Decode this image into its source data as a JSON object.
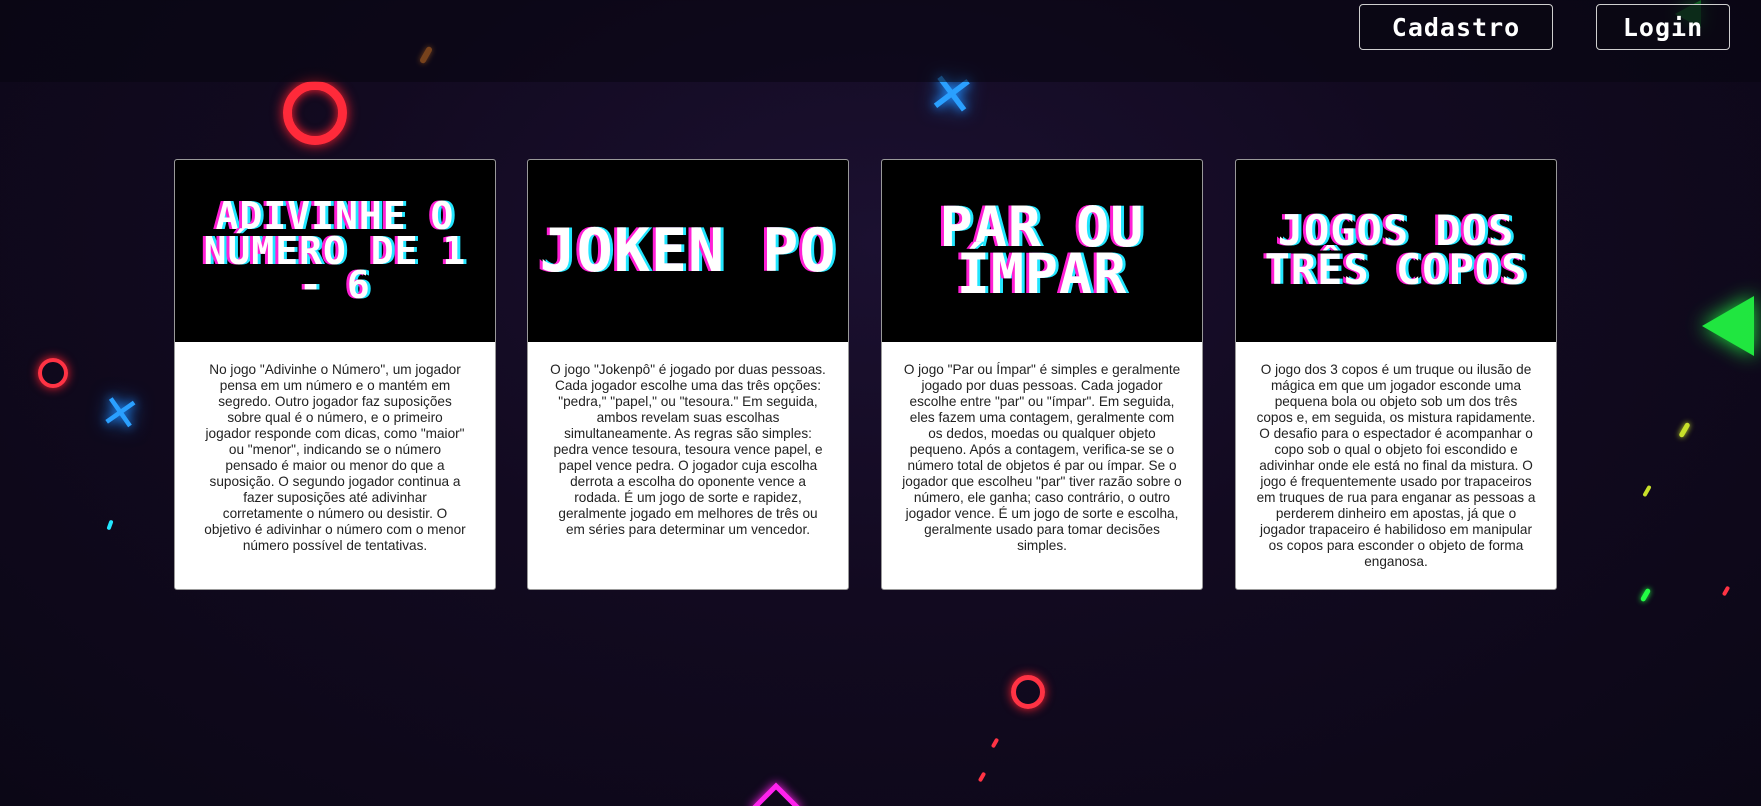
{
  "nav": {
    "cadastro_label": "Cadastro",
    "login_label": "Login"
  },
  "games": [
    {
      "title": "Adivinhe o Número de 1 - 6",
      "description": "No jogo \"Adivinhe o Número\", um jogador pensa em um número e o mantém em segredo. Outro jogador faz suposições sobre qual é o número, e o primeiro jogador responde com dicas, como \"maior\" ou \"menor\", indicando se o número pensado é maior ou menor do que a suposição. O segundo jogador continua a fazer suposições até adivinhar corretamente o número ou desistir. O objetivo é adivinhar o número com o menor número possível de tentativas."
    },
    {
      "title": "Joken Po",
      "description": "O jogo \"Jokenpô\" é jogado por duas pessoas. Cada jogador escolhe uma das três opções: \"pedra,\" \"papel,\" ou \"tesoura.\" Em seguida, ambos revelam suas escolhas simultaneamente. As regras são simples: pedra vence tesoura, tesoura vence papel, e papel vence pedra. O jogador cuja escolha derrota a escolha do oponente vence a rodada. É um jogo de sorte e rapidez, geralmente jogado em melhores de três ou em séries para determinar um vencedor."
    },
    {
      "title": "Par ou Ímpar",
      "description": "O jogo \"Par ou Ímpar\" é simples e geralmente jogado por duas pessoas. Cada jogador escolhe entre \"par\" ou \"ímpar\". Em seguida, eles fazem uma contagem, geralmente com os dedos, moedas ou qualquer objeto pequeno. Após a contagem, verifica-se se o número total de objetos é par ou ímpar. Se o jogador que escolheu \"par\" tiver razão sobre o número, ele ganha; caso contrário, o outro jogador vence. É um jogo de sorte e escolha, geralmente usado para tomar decisões simples."
    },
    {
      "title": "Jogos dos Três Copos",
      "description": "O jogo dos 3 copos é um truque ou ilusão de mágica em que um jogador esconde uma pequena bola ou objeto sob um dos três copos e, em seguida, os mistura rapidamente. O desafio para o espectador é acompanhar o copo sob o qual o objeto foi escondido e adivinhar onde ele está no final da mistura. O jogo é frequentemente usado por trapaceiros em truques de rua para enganar as pessoas a perderem dinheiro em apostas, já que o jogador trapaceiro é habilidoso em manipular os copos para esconder o objeto de forma enganosa."
    }
  ],
  "background_icons": [
    "circle-icon",
    "cross-icon",
    "triangle-icon",
    "square-icon"
  ],
  "colors": {
    "background": "#120a20",
    "neon_red": "#ff2a3a",
    "neon_blue": "#2aa0ff",
    "neon_green": "#22ff44",
    "neon_pink": "#ff1fd6",
    "neon_cyan": "#22e6ff"
  }
}
